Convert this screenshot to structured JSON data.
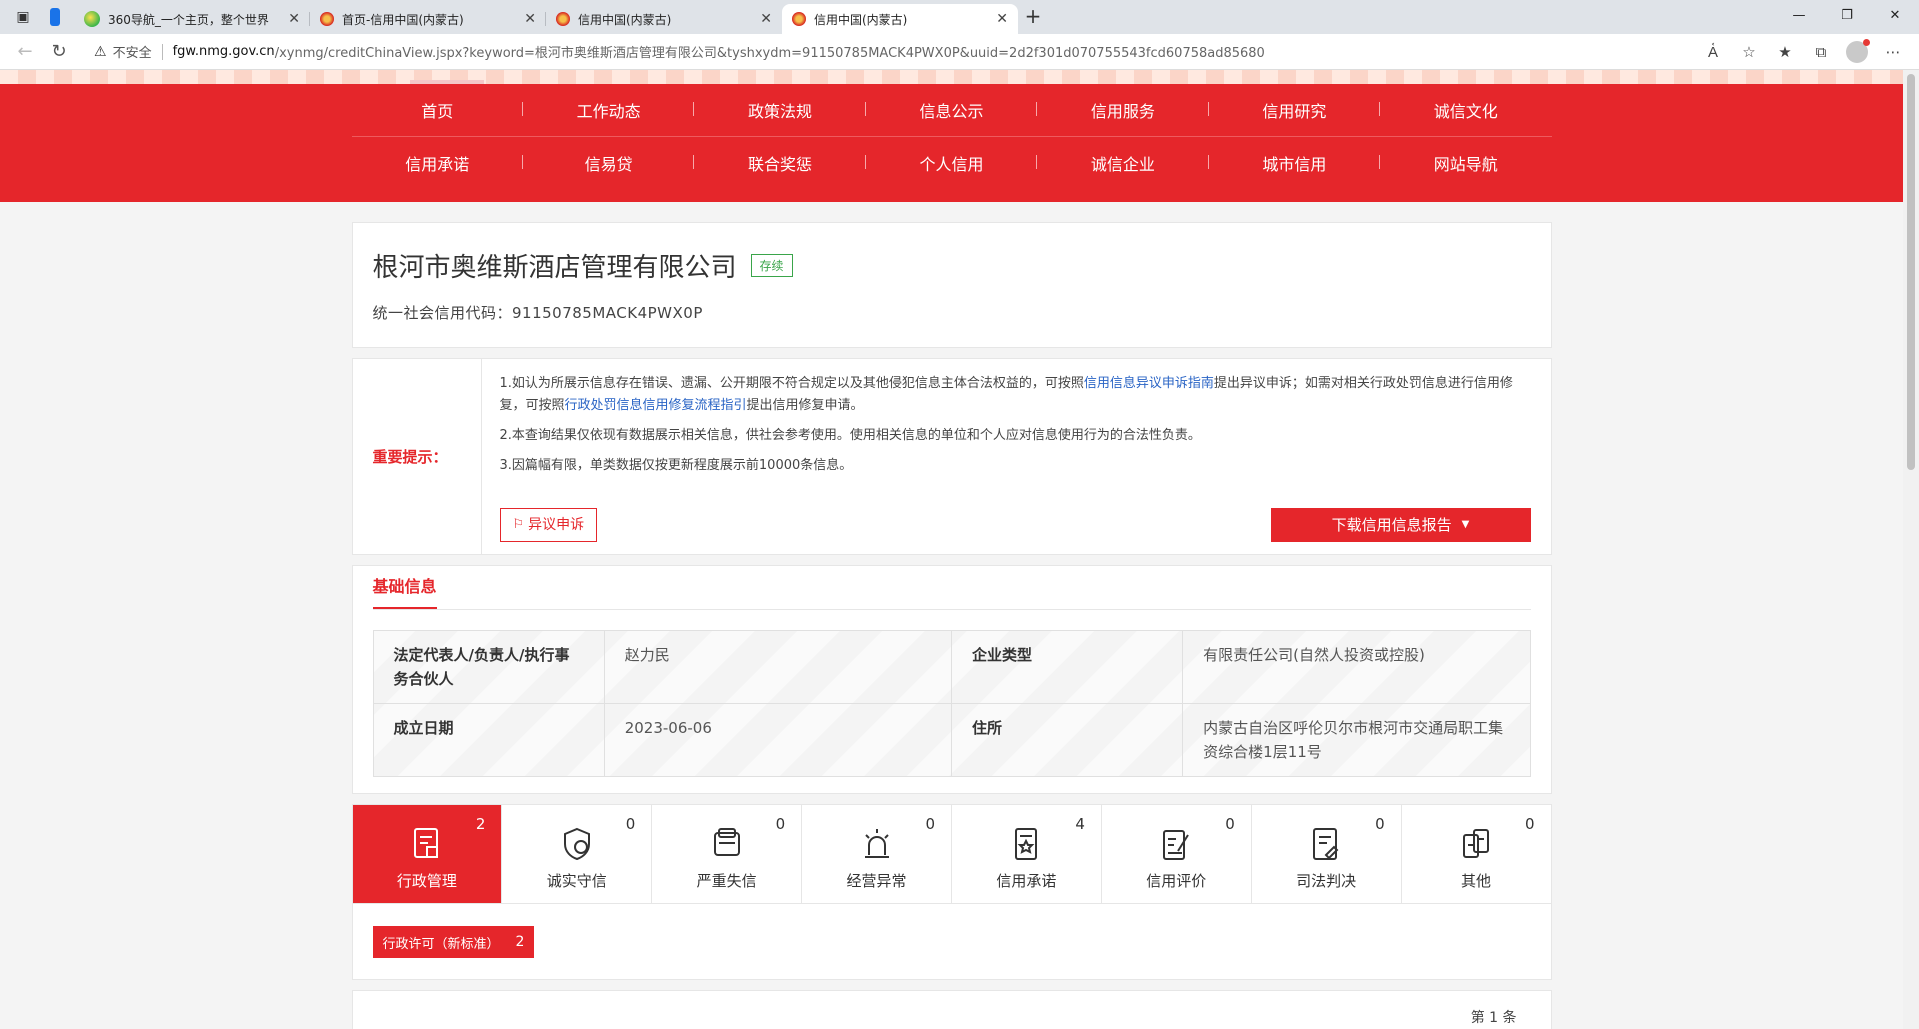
{
  "browser": {
    "tabs": [
      {
        "title": "360导航_一个主页，整个世界",
        "favicon": "360-icon"
      },
      {
        "title": "首页-信用中国(内蒙古)",
        "favicon": "emblem-icon"
      },
      {
        "title": "信用中国(内蒙古)",
        "favicon": "emblem-icon"
      },
      {
        "title": "信用中国(内蒙古)",
        "favicon": "emblem-icon",
        "active": true
      }
    ],
    "insecure_label": "不安全",
    "url_host": "fgw.nmg.gov.cn",
    "url_path": "/xynmg/creditChinaView.jspx?keyword=根河市奥维斯酒店管理有限公司&tyshxydm=91150785MACK4PWX0P&uuid=2d2f301d070755543fcd60758ad85680"
  },
  "nav": {
    "row1": [
      "首页",
      "工作动态",
      "政策法规",
      "信息公示",
      "信用服务",
      "信用研究",
      "诚信文化"
    ],
    "row2": [
      "信用承诺",
      "信易贷",
      "联合奖惩",
      "个人信用",
      "诚信企业",
      "城市信用",
      "网站导航"
    ]
  },
  "company": {
    "name": "根河市奥维斯酒店管理有限公司",
    "status": "存续",
    "credit_code": "统一社会信用代码：91150785MACK4PWX0P"
  },
  "notice": {
    "label": "重要提示：",
    "p1_a": "1.如认为所展示信息存在错误、遗漏、公开期限不符合规定以及其他侵犯信息主体合法权益的，可按照",
    "p1_link1": "信用信息异议申诉指南",
    "p1_b": "提出异议申诉；如需对相关行政处罚信息进行信用修复，可按照",
    "p1_link2": "行政处罚信息信用修复流程指引",
    "p1_c": "提出信用修复申请。",
    "p2": "2.本查询结果仅依现有数据展示相关信息，供社会参考使用。使用相关信息的单位和个人应对信息使用行为的合法性负责。",
    "p3": "3.因篇幅有限，单类数据仅按更新程度展示前10000条信息。",
    "appeal_btn": "异议申诉",
    "download_btn": "下载信用信息报告"
  },
  "basic": {
    "title": "基础信息",
    "rows": [
      [
        {
          "k": "法定代表人/负责人/执行事务合伙人",
          "v": "赵力民"
        },
        {
          "k": "企业类型",
          "v": "有限责任公司(自然人投资或控股)"
        }
      ],
      [
        {
          "k": "成立日期",
          "v": "2023-06-06"
        },
        {
          "k": "住所",
          "v": "内蒙古自治区呼伦贝尔市根河市交通局职工集资综合楼1层11号"
        }
      ]
    ]
  },
  "categories": [
    {
      "label": "行政管理",
      "count": "2",
      "icon": "admin-doc-icon",
      "active": true
    },
    {
      "label": "诚实守信",
      "count": "0",
      "icon": "shield-credit-icon"
    },
    {
      "label": "严重失信",
      "count": "0",
      "icon": "dishonest-icon"
    },
    {
      "label": "经营异常",
      "count": "0",
      "icon": "alarm-icon"
    },
    {
      "label": "信用承诺",
      "count": "4",
      "icon": "commitment-icon"
    },
    {
      "label": "信用评价",
      "count": "0",
      "icon": "evaluation-icon"
    },
    {
      "label": "司法判决",
      "count": "0",
      "icon": "judgment-icon"
    },
    {
      "label": "其他",
      "count": "0",
      "icon": "other-icon"
    }
  ],
  "sub_tab": {
    "label": "行政许可（新标准）",
    "count": "2"
  },
  "list": {
    "page_count": "第 1 条"
  },
  "colors": {
    "brand_red": "#e5262b",
    "link_blue": "#2a64c5",
    "status_green": "#3aa54a"
  }
}
